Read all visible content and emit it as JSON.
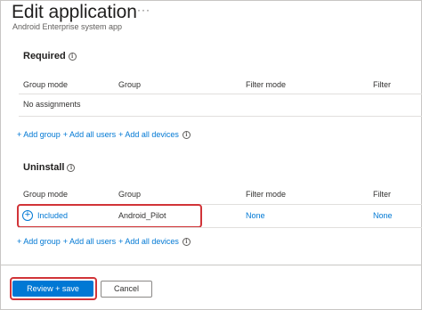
{
  "header": {
    "title": "Edit application",
    "more_glyph": "···",
    "subtitle": "Android Enterprise system app"
  },
  "required": {
    "title": "Required",
    "columns": [
      "Group mode",
      "Group",
      "Filter mode",
      "Filter"
    ],
    "empty_text": "No assignments",
    "add_group": "+ Add group",
    "add_all_users": "+ Add all users",
    "add_all_devices": "+ Add all devices"
  },
  "uninstall": {
    "title": "Uninstall",
    "columns": [
      "Group mode",
      "Group",
      "Filter mode",
      "Filter"
    ],
    "rows": [
      {
        "group_mode": "Included",
        "group": "Android_Pilot",
        "filter_mode": "None",
        "filter": "None"
      }
    ],
    "add_group": "+ Add group",
    "add_all_users": "+ Add all users",
    "add_all_devices": "+ Add all devices"
  },
  "footer": {
    "review_save": "Review + save",
    "cancel": "Cancel"
  },
  "colors": {
    "accent": "#0078d4",
    "highlight": "#d13438"
  },
  "icons": [
    "info-icon",
    "plus-circle-icon",
    "more-icon"
  ]
}
